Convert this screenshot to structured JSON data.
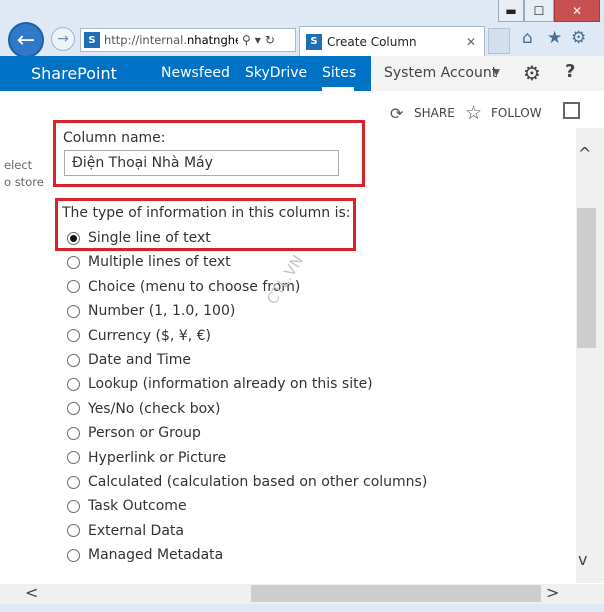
{
  "browser": {
    "window_buttons": {
      "minimize": "▬",
      "maximize": "☐",
      "close": "✕"
    },
    "back_icon": "back-arrow-icon",
    "forward_icon": "forward-arrow-icon",
    "address": {
      "prefix": "http://internal.",
      "domain": "nhatnghe...",
      "search_icon": "⚲",
      "dropdown_icon": "▾",
      "refresh_icon": "↻"
    },
    "tab": {
      "title": "Create Column",
      "close": "✕"
    },
    "toolbar_icons": {
      "home": "⌂",
      "favorites": "★",
      "tools": "⚙"
    }
  },
  "suitebar": {
    "brand": "SharePoint",
    "nav": [
      "Newsfeed",
      "SkyDrive",
      "Sites"
    ],
    "active_nav": "Sites",
    "user": "System Account",
    "user_caret": "▼",
    "settings_icon": "⚙",
    "help_icon": "?"
  },
  "actions": {
    "share_icon": "⟳",
    "share_label": "SHARE",
    "follow_icon": "☆",
    "follow_label": "FOLLOW"
  },
  "left_clipped": [
    "elect",
    "o store"
  ],
  "form": {
    "column_name_label": "Column name:",
    "column_name_value": "Điện Thoại Nhà Máy",
    "type_question": "The type of information in this column is:",
    "options": [
      "Single line of text",
      "Multiple lines of text",
      "Choice (menu to choose from)",
      "Number (1, 1.0, 100)",
      "Currency ($, ¥, €)",
      "Date and Time",
      "Lookup (information already on this site)",
      "Yes/No (check box)",
      "Person or Group",
      "Hyperlink or Picture",
      "Calculated (calculation based on other columns)",
      "Task Outcome",
      "External Data",
      "Managed Metadata"
    ],
    "selected_option": "Single line of text"
  },
  "watermark": "CTL.VN",
  "scroll": {
    "up": "^",
    "down": "v",
    "left": "<",
    "right": ">"
  },
  "colors": {
    "suite_blue": "#0072c6",
    "highlight_red": "#d9222a",
    "chrome_bg": "#dfe9f5"
  }
}
